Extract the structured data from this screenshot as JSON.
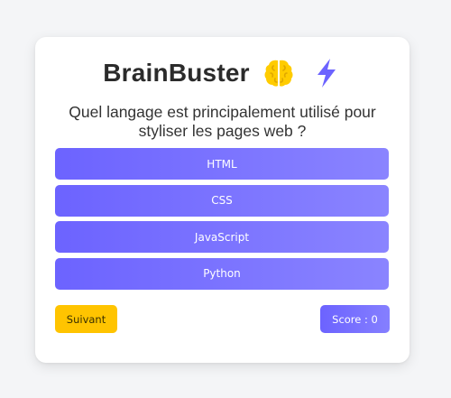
{
  "app": {
    "title": "BrainBuster",
    "icons": [
      "brain-icon",
      "lightning-bolt-icon"
    ]
  },
  "quiz": {
    "question": "Quel langage est principalement utilisé pour styliser les pages web ?",
    "answers": [
      {
        "label": "HTML"
      },
      {
        "label": "CSS"
      },
      {
        "label": "JavaScript"
      },
      {
        "label": "Python"
      }
    ]
  },
  "footer": {
    "next_label": "Suivant",
    "score_text": "Score : 0"
  },
  "colors": {
    "accent": "#6c63ff",
    "accent_light": "#8a84ff",
    "next_button": "#ffc400",
    "brain": "#ffcc00",
    "bolt": "#6c63ff"
  }
}
